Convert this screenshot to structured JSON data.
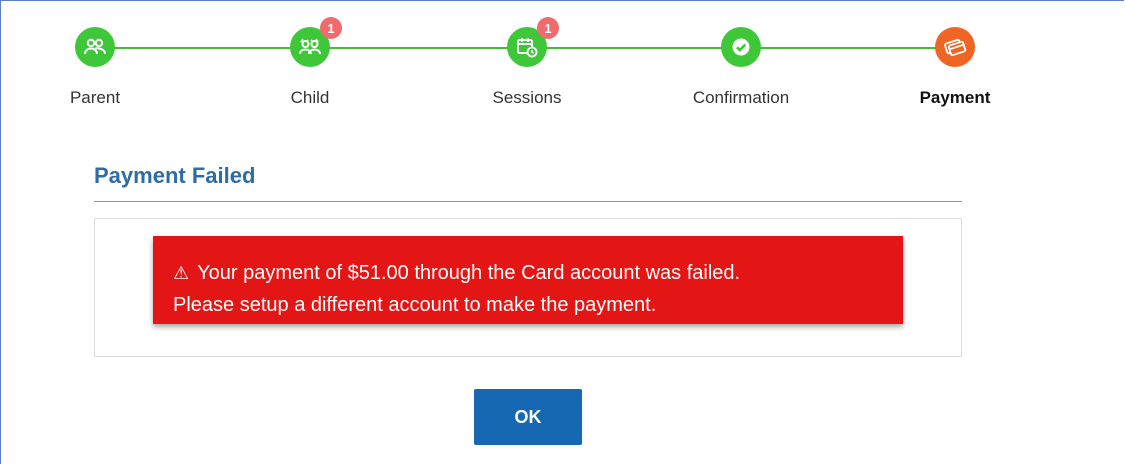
{
  "stepper": {
    "steps": [
      {
        "label": "Parent",
        "icon": "parent-icon",
        "badge": null,
        "color": "#3fc73a"
      },
      {
        "label": "Child",
        "icon": "child-icon",
        "badge": "1",
        "color": "#3fc73a"
      },
      {
        "label": "Sessions",
        "icon": "calendar-clock-icon",
        "badge": "1",
        "color": "#3fc73a"
      },
      {
        "label": "Confirmation",
        "icon": "check-icon",
        "badge": null,
        "color": "#3fc73a"
      },
      {
        "label": "Payment",
        "icon": "credit-card-icon",
        "badge": null,
        "color": "#f06524",
        "active": true
      }
    ]
  },
  "page": {
    "title": "Payment Failed"
  },
  "alert": {
    "icon": "warning-icon",
    "icon_glyph": "⚠",
    "line1": "Your payment of $51.00 through the Card account was failed.",
    "line2": "Please setup a different account to make the payment.",
    "color": "#e41515"
  },
  "actions": {
    "ok_label": "OK",
    "ok_color": "#1768b3"
  }
}
